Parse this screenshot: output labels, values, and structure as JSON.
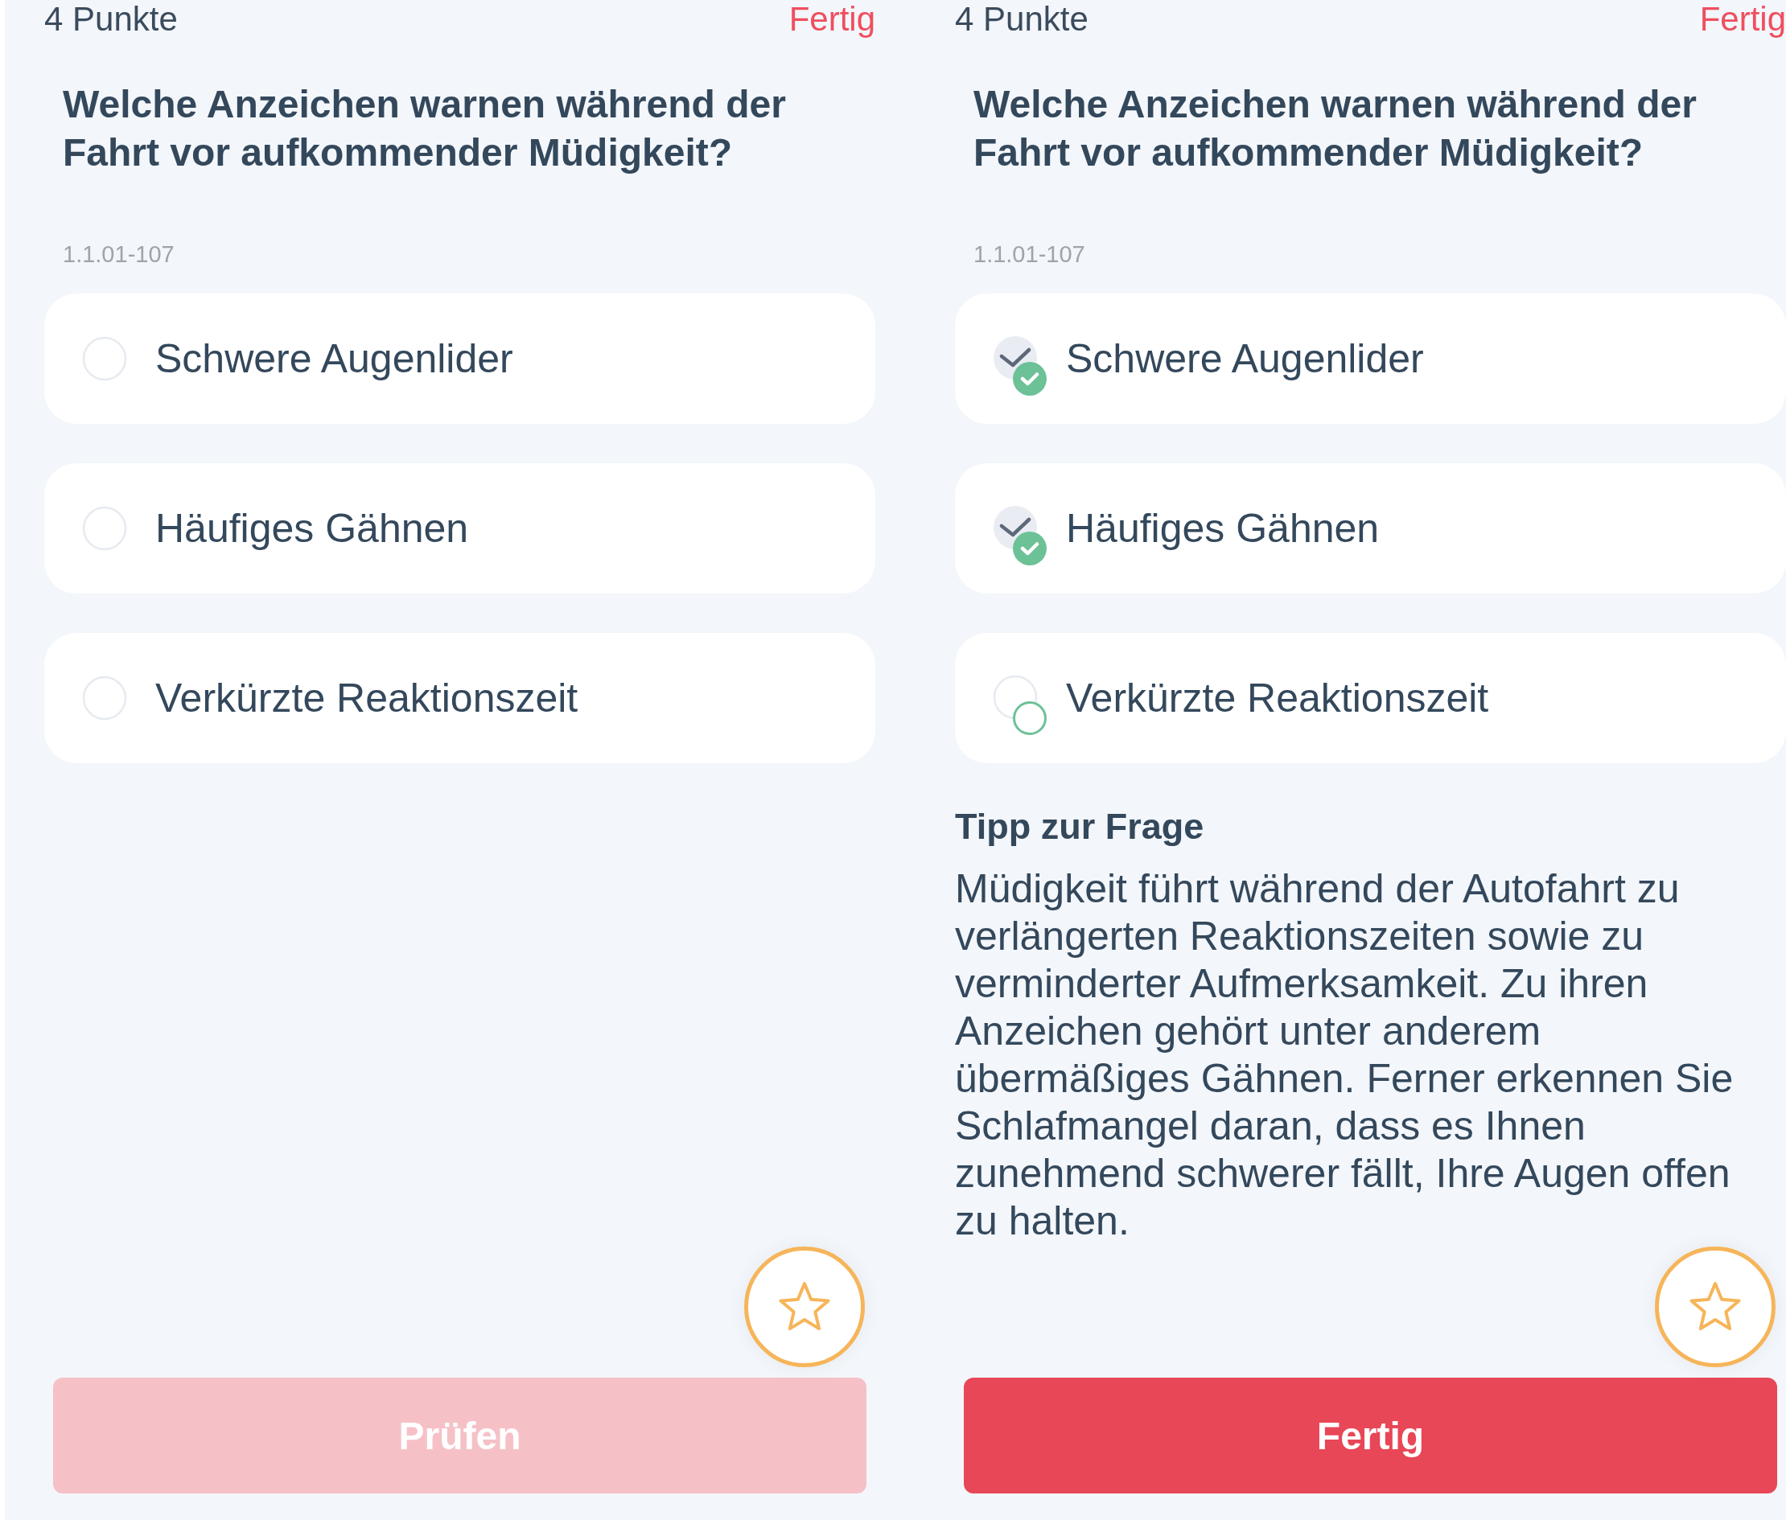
{
  "screens": [
    {
      "points": "4 Punkte",
      "finish_link": "Fertig",
      "question": "Welche Anzeichen warnen während der Fahrt vor aufkommender Müdigkeit?",
      "question_code": "1.1.01-107",
      "answers": [
        {
          "text": "Schwere Augenlider",
          "selected": false
        },
        {
          "text": "Häufiges Gähnen",
          "selected": false
        },
        {
          "text": "Verkürzte Reaktionszeit",
          "selected": false
        }
      ],
      "favorite": {
        "starred": false
      },
      "action_button": {
        "label": "Prüfen",
        "disabled": true
      }
    },
    {
      "points": "4 Punkte",
      "finish_link": "Fertig",
      "question": "Welche Anzeichen warnen während der Fahrt vor aufkommender Müdigkeit?",
      "question_code": "1.1.01-107",
      "answers": [
        {
          "text": "Schwere Augenlider",
          "selected": true,
          "correct": true
        },
        {
          "text": "Häufiges Gähnen",
          "selected": true,
          "correct": true
        },
        {
          "text": "Verkürzte Reaktionszeit",
          "selected": false,
          "correct": false
        }
      ],
      "tip": {
        "title": "Tipp zur Frage",
        "text": "Müdigkeit führt während der Autofahrt zu verlängerten Reaktionszeiten sowie zu verminderter Aufmerksamkeit. Zu ihren Anzeichen gehört unter anderem übermäßiges Gähnen. Ferner erkennen Sie Schlafmangel daran, dass es Ihnen zunehmend schwerer fällt, Ihre Augen offen zu halten."
      },
      "favorite": {
        "starred": false
      },
      "action_button": {
        "label": "Fertig",
        "disabled": false
      }
    }
  ]
}
